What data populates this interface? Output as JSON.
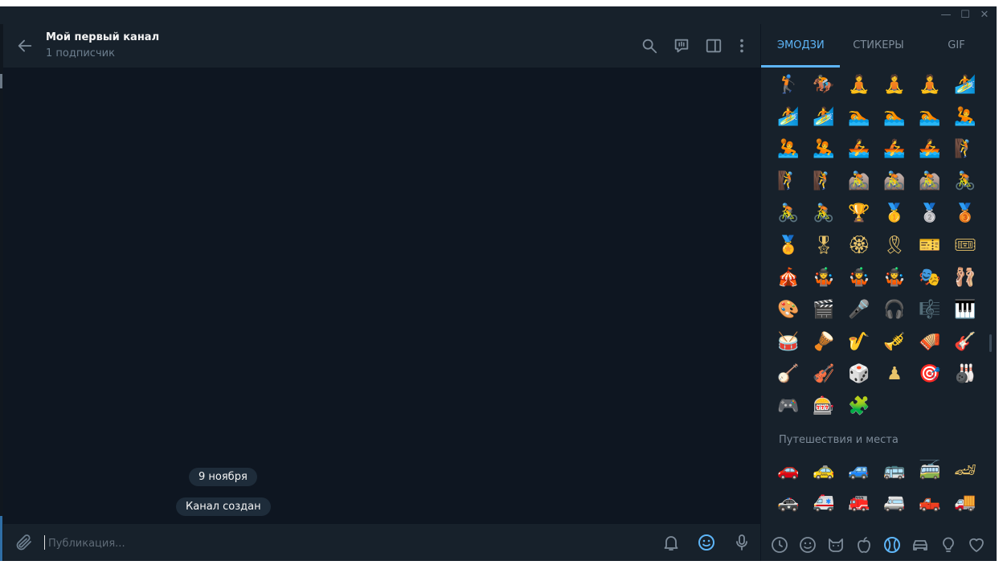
{
  "window": {
    "controls": [
      "—",
      "☐",
      "✕"
    ]
  },
  "chat": {
    "title": "Мой первый канал",
    "subtitle": "1 подписчик",
    "date_pill": "9 ноября",
    "service_message": "Канал создан"
  },
  "input": {
    "placeholder": "Публикация..."
  },
  "panel": {
    "tabs": [
      "ЭМОДЗИ",
      "СТИКЕРЫ",
      "GIF"
    ],
    "active_tab": "ЭМОДЗИ",
    "activity_rows": [
      [
        "🏌",
        "🏇",
        "🧘",
        "🧘",
        "🧘",
        "🏄"
      ],
      [
        "🏄",
        "🏄",
        "🏊",
        "🏊",
        "🏊",
        "🤽"
      ],
      [
        "🤽",
        "🤽",
        "🚣",
        "🚣",
        "🚣",
        "🧗"
      ],
      [
        "🧗",
        "🧗",
        "🚵",
        "🚵",
        "🚵",
        "🚴"
      ],
      [
        "🚴",
        "🚴",
        "🏆",
        "🥇",
        "🥈",
        "🥉"
      ],
      [
        "🏅",
        "🎖",
        "🏵",
        "🎗",
        "🎫",
        "🎟"
      ],
      [
        "🎪",
        "🤹",
        "🤹",
        "🤹",
        "🎭",
        "🩰"
      ],
      [
        "🎨",
        "🎬",
        "🎤",
        "🎧",
        "🎼",
        "🎹"
      ],
      [
        "🥁",
        "🪘",
        "🎷",
        "🎺",
        "🪗",
        "🎸"
      ],
      [
        "🪕",
        "🎻",
        "🎲",
        "♟",
        "🎯",
        "🎳"
      ],
      [
        "🎮",
        "🎰",
        "🧩"
      ]
    ],
    "travel_title": "Путешествия и места",
    "travel_rows": [
      [
        "🚗",
        "🚕",
        "🚙",
        "🚌",
        "🚎",
        "🏎"
      ],
      [
        "🚓",
        "🚑",
        "🚒",
        "🚐",
        "🛻",
        "🚚"
      ]
    ],
    "categories": [
      "recent-icon",
      "smile-icon",
      "cat-icon",
      "apple-icon",
      "ball-icon",
      "car-icon",
      "bulb-icon",
      "heart-icon"
    ],
    "active_category": "ball-icon"
  },
  "colors": {
    "bg_dark": "#0e1621",
    "bg_panel": "#17212b",
    "accent": "#5eb5f7",
    "icon": "#6d7f8f"
  }
}
